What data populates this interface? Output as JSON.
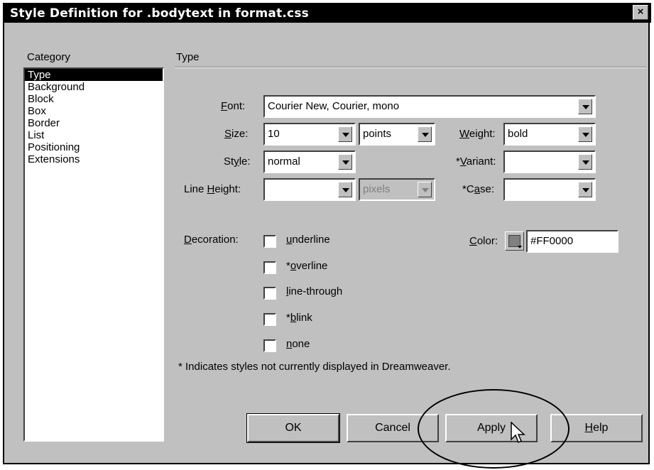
{
  "window": {
    "title": "Style Definition for .bodytext in format.css",
    "close_label": "×"
  },
  "category": {
    "heading": "Category",
    "items": [
      "Type",
      "Background",
      "Block",
      "Box",
      "Border",
      "List",
      "Positioning",
      "Extensions"
    ],
    "selected": "Type"
  },
  "panel": {
    "heading": "Type"
  },
  "font": {
    "label_u": "F",
    "label_rest": "ont:",
    "value": "Courier New, Courier, mono"
  },
  "size": {
    "label_u": "S",
    "label_rest": "ize:",
    "value": "10",
    "unit": "points"
  },
  "weight": {
    "label_u": "W",
    "label_rest": "eight:",
    "value": "bold"
  },
  "style": {
    "label_pre": "St",
    "label_u": "y",
    "label_rest": "le:",
    "value": "normal"
  },
  "variant": {
    "label_pre": "*",
    "label_u": "V",
    "label_rest": "ariant:",
    "value": ""
  },
  "line_height": {
    "label_pre": "Line ",
    "label_u": "H",
    "label_rest": "eight:",
    "value": "",
    "unit": "pixels"
  },
  "case": {
    "label_pre": "*C",
    "label_u": "a",
    "label_rest": "se:",
    "value": ""
  },
  "color": {
    "label_u": "C",
    "label_rest": "olor:",
    "value": "#FF0000"
  },
  "decoration": {
    "label_u": "D",
    "label_rest": "ecoration:",
    "options": [
      {
        "pre": "",
        "u": "u",
        "rest": "nderline",
        "checked": false
      },
      {
        "pre": "*",
        "u": "o",
        "rest": "verline",
        "checked": false
      },
      {
        "pre": "",
        "u": "l",
        "rest": "ine-through",
        "checked": false
      },
      {
        "pre": "*",
        "u": "b",
        "rest": "link",
        "checked": false
      },
      {
        "pre": "",
        "u": "n",
        "rest": "one",
        "checked": false
      }
    ]
  },
  "note": "* Indicates styles not currently displayed in Dreamweaver.",
  "buttons": {
    "ok": "OK",
    "cancel": "Cancel",
    "apply": "Apply",
    "help_u": "H",
    "help_rest": "elp"
  }
}
